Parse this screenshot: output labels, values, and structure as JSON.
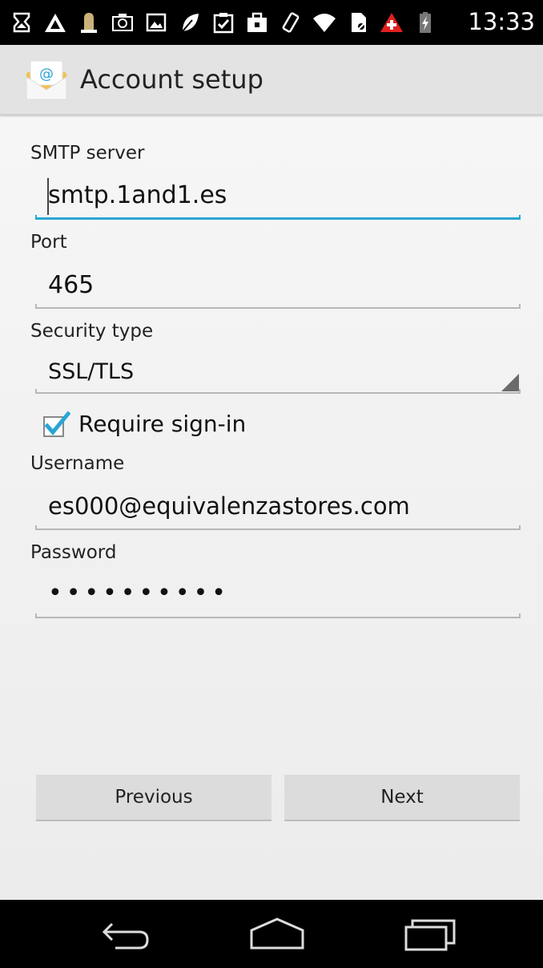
{
  "status_bar": {
    "time": "13:33",
    "icons": [
      "download-icon",
      "warning-triangle-icon",
      "bell-icon",
      "camera-icon",
      "image-icon",
      "leaf-icon",
      "clipboard-check-icon",
      "briefcase-icon",
      "vibrate-icon",
      "wifi-icon",
      "no-sim-icon",
      "first-aid-icon",
      "battery-charging-icon"
    ]
  },
  "action_bar": {
    "title": "Account setup",
    "icon": "email-app-icon"
  },
  "form": {
    "smtp_label": "SMTP server",
    "smtp_value": "smtp.1and1.es",
    "port_label": "Port",
    "port_value": "465",
    "security_label": "Security type",
    "security_value": "SSL/TLS",
    "require_signin_label": "Require sign-in",
    "require_signin_checked": true,
    "username_label": "Username",
    "username_value": "es000@equivalenzastores.com",
    "password_label": "Password",
    "password_value": "••••••••••"
  },
  "buttons": {
    "previous": "Previous",
    "next": "Next"
  },
  "nav_bar": {
    "icons": [
      "back-icon",
      "home-icon",
      "recents-icon"
    ]
  },
  "colors": {
    "accent": "#2aa5d6",
    "checkbox": "#2aa5d6"
  }
}
